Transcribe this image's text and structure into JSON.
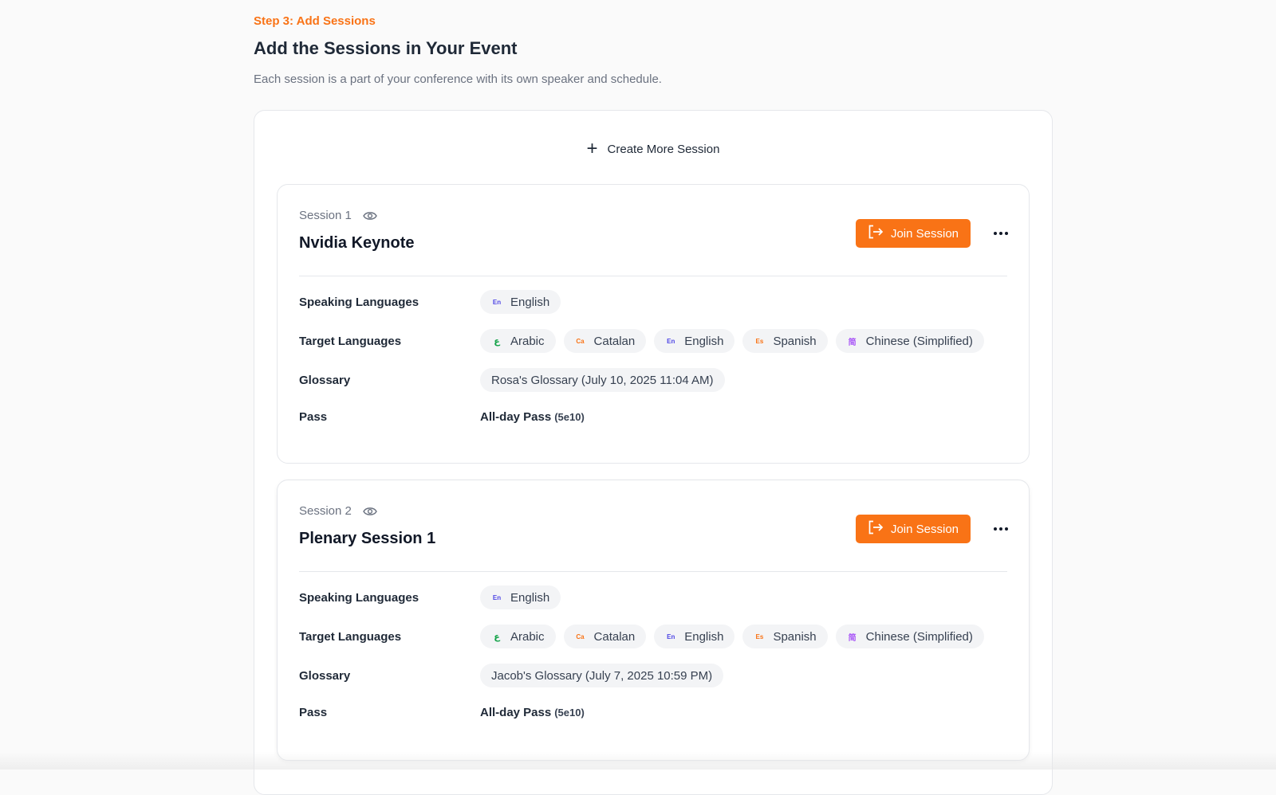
{
  "header": {
    "step": "Step 3: Add Sessions",
    "title": "Add the Sessions in Your Event",
    "subtitle": "Each session is a part of your conference with its own speaker and schedule."
  },
  "create_label": "Create More Session",
  "labels": {
    "speaking": "Speaking Languages",
    "target": "Target Languages",
    "glossary": "Glossary",
    "pass": "Pass",
    "join": "Join Session"
  },
  "languages": {
    "arabic": {
      "icon": "ع",
      "name": "Arabic"
    },
    "catalan": {
      "icon": "Ca",
      "name": "Catalan"
    },
    "english": {
      "icon": "En",
      "name": "English"
    },
    "spanish": {
      "icon": "Es",
      "name": "Spanish"
    },
    "chinese": {
      "icon": "简",
      "name": "Chinese (Simplified)"
    }
  },
  "sessions": [
    {
      "number": "Session 1",
      "name": "Nvidia Keynote",
      "speaking": "English",
      "glossary": "Rosa's Glossary (July 10, 2025 11:04 AM)",
      "pass_name": "All-day Pass",
      "pass_code": "(5e10)"
    },
    {
      "number": "Session 2",
      "name": "Plenary Session 1",
      "speaking": "English",
      "glossary": "Jacob's Glossary (July 7, 2025 10:59 PM)",
      "pass_name": "All-day Pass",
      "pass_code": "(5e10)"
    }
  ],
  "colors": {
    "accent": "#f97316",
    "background": "#fafafa",
    "pill": "#f3f4f6"
  }
}
